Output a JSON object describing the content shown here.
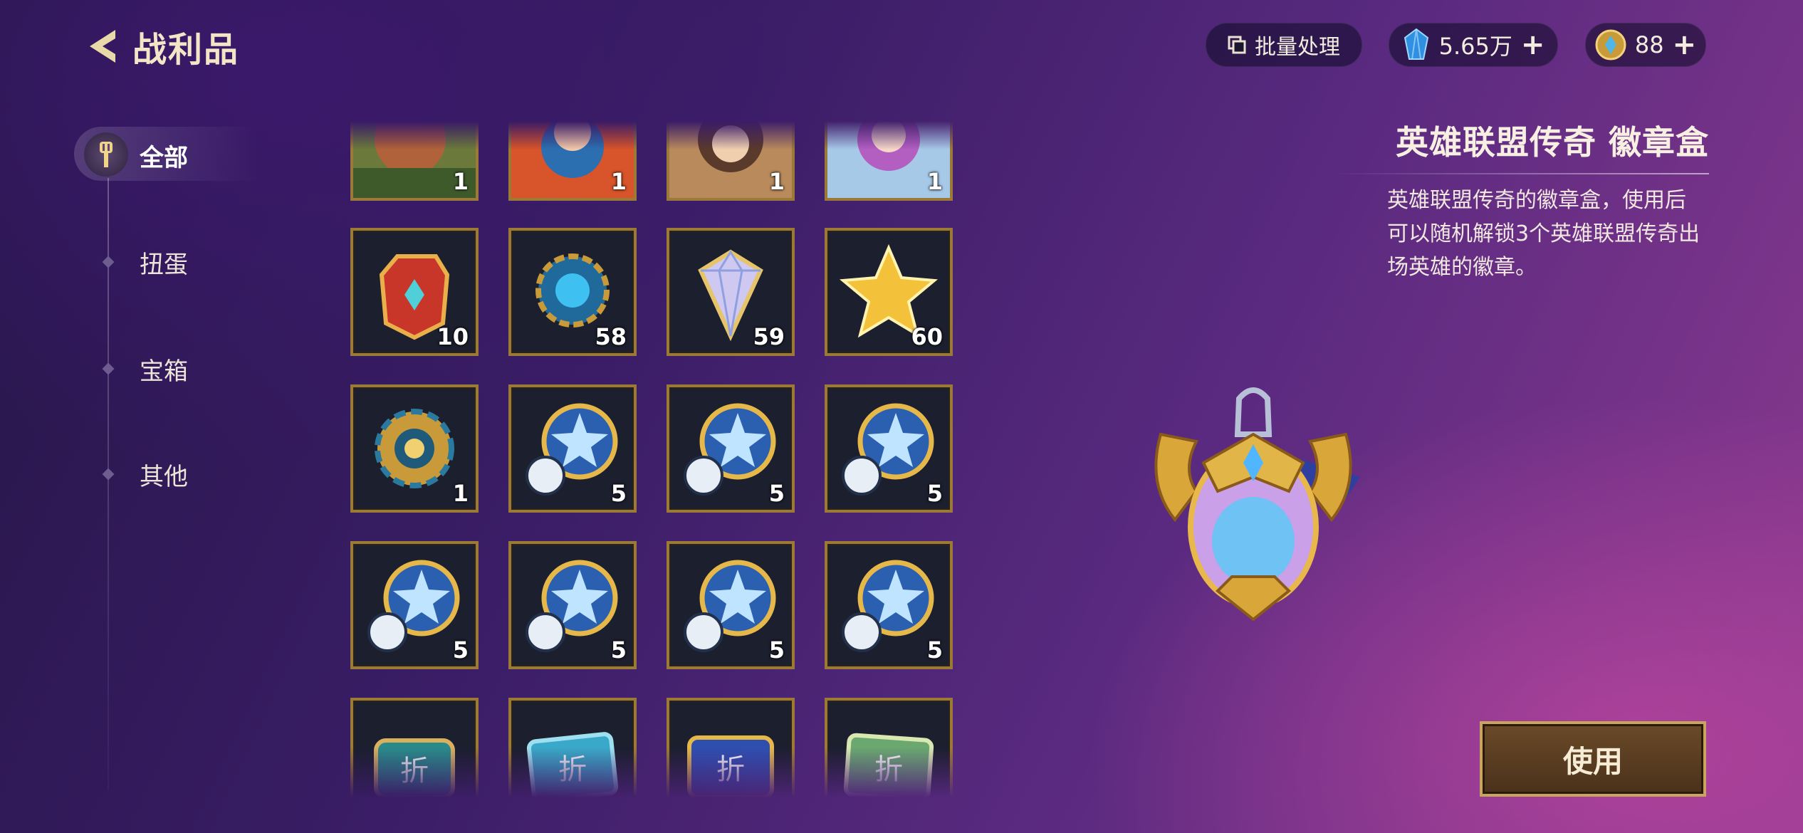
{
  "header": {
    "title": "战利品",
    "batch_label": "批量处理",
    "gems": "5.65万",
    "coins": "88"
  },
  "sidebar": {
    "items": [
      {
        "label": "全部",
        "active": true
      },
      {
        "label": "扭蛋"
      },
      {
        "label": "宝箱"
      },
      {
        "label": "其他"
      }
    ]
  },
  "grid": {
    "row0": [
      "1",
      "1",
      "1",
      "1"
    ],
    "row1": [
      "10",
      "58",
      "59",
      "60"
    ],
    "row2": [
      "1",
      "5",
      "5",
      "5"
    ],
    "row3": [
      "5",
      "5",
      "5",
      "5"
    ],
    "row4_icon_text": "折"
  },
  "detail": {
    "title": "英雄联盟传奇  徽章盒",
    "description": "英雄联盟传奇的徽章盒，使用后可以随机解锁3个英雄联盟传奇出场英雄的徽章。",
    "use_label": "使用"
  },
  "colors": {
    "frame_gold": "#9b7a38",
    "cell_bg": "#1c1f2e",
    "button_brown": "#5a3d22"
  },
  "icons": {
    "back": "chevron-left-icon",
    "batch": "batch-icon",
    "gem": "blue-gem-icon",
    "coin": "gold-coin-icon",
    "nav": "spatula-icon"
  }
}
